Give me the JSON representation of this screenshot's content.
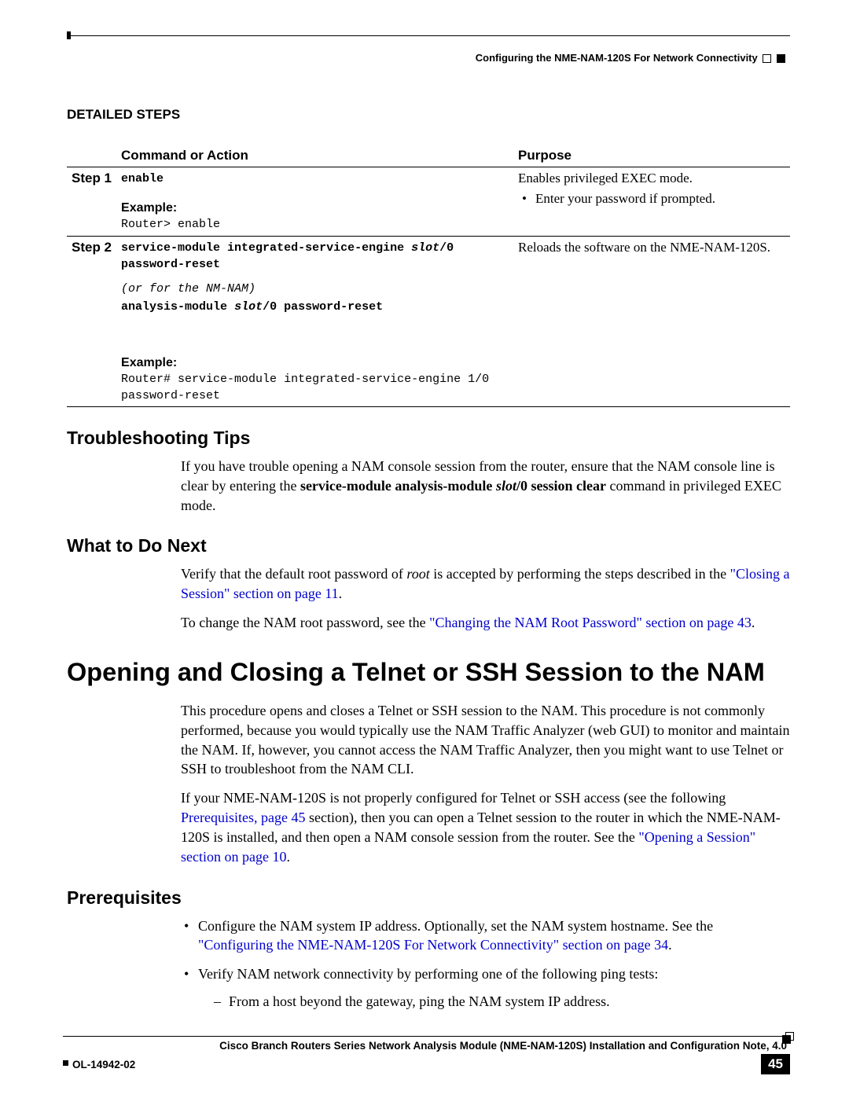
{
  "header": {
    "section": "Configuring the NME-NAM-120S For Network Connectivity"
  },
  "detailed_steps_heading": "DETAILED STEPS",
  "table": {
    "th_command": "Command or Action",
    "th_purpose": "Purpose",
    "step1_label": "Step 1",
    "step1_cmd": "enable",
    "step1_example_label": "Example:",
    "step1_example_code": "Router> enable",
    "step1_purpose_line": "Enables privileged EXEC mode.",
    "step1_purpose_bullet": "Enter your password if prompted.",
    "step2_label": "Step 2",
    "step2_cmd_a": "service-module integrated-service-engine",
    "step2_cmd_a_slot": " slot",
    "step2_cmd_a_tail": "/0",
    "step2_cmd_b": "password-reset",
    "step2_paren": "(or for the NM-NAM)",
    "step2_cmd_c_a": "analysis-module ",
    "step2_cmd_c_slot": "slot",
    "step2_cmd_c_tail": "/0 password-reset",
    "step2_example_label": "Example:",
    "step2_example_code": "Router# service-module integrated-service-engine 1/0 password-reset",
    "step2_purpose": "Reloads the software on the NME-NAM-120S."
  },
  "troubleshooting": {
    "heading": "Troubleshooting Tips",
    "p_pre": "If you have trouble opening a NAM console session from the router, ensure that the NAM console line is clear by entering the ",
    "p_cmd_a": "service-module analysis-module ",
    "p_cmd_slot": "slot",
    "p_cmd_b": "/0 session clear",
    "p_post": " command in privileged EXEC mode."
  },
  "whatnext": {
    "heading": "What to Do Next",
    "p1_pre": "Verify that the default root password of ",
    "p1_root": "root",
    "p1_post": " is accepted by performing the steps described in the ",
    "p1_link": "\"Closing a Session\" section on page 11",
    "p1_end": ".",
    "p2_pre": "To change the NAM root password, see the ",
    "p2_link": "\"Changing the NAM Root Password\" section on page 43",
    "p2_end": "."
  },
  "main": {
    "heading": "Opening and Closing a Telnet or SSH Session to the NAM",
    "p1": "This procedure opens and closes a Telnet or SSH session to the NAM. This procedure is not commonly performed, because you would typically use the NAM Traffic Analyzer (web GUI) to monitor and maintain the NAM. If, however, you cannot access the NAM Traffic Analyzer, then you might want to use Telnet or SSH to troubleshoot from the NAM CLI.",
    "p2_a": "If your NME-NAM-120S is not properly configured for Telnet or SSH access (see the following ",
    "p2_link1": "Prerequisites, page 45",
    "p2_b": " section), then you can open a Telnet session to the router in which the NME-NAM-120S is installed, and then open a NAM console session from the router. See the ",
    "p2_link2": "\"Opening a Session\" section on page 10",
    "p2_c": "."
  },
  "prereq": {
    "heading": "Prerequisites",
    "li1_a": "Configure the NAM system IP address. Optionally, set the NAM system hostname. See the ",
    "li1_link": "\"Configuring the NME-NAM-120S For Network Connectivity\" section on page 34",
    "li1_b": ".",
    "li2": "Verify NAM network connectivity by performing one of the following ping tests:",
    "li2_sub": "From a host beyond the gateway, ping the NAM system IP address."
  },
  "footer": {
    "doctitle": "Cisco Branch Routers Series Network Analysis Module (NME-NAM-120S) Installation and Configuration Note, 4.0",
    "docnum": "OL-14942-02",
    "pagenum": "45"
  }
}
